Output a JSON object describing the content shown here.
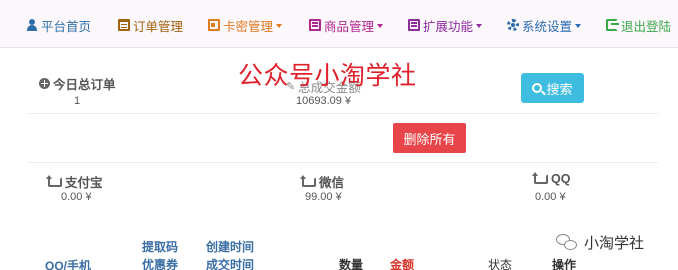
{
  "nav": {
    "items": [
      {
        "label": "平台首页",
        "icon": "user-icon",
        "color": "#2c6fa8",
        "dropdown": false
      },
      {
        "label": "订单管理",
        "icon": "list-icon",
        "color": "#a0620e",
        "dropdown": false
      },
      {
        "label": "卡密管理",
        "icon": "card-icon",
        "color": "#e07a1e",
        "dropdown": true
      },
      {
        "label": "商品管理",
        "icon": "box-icon",
        "color": "#b0278f",
        "dropdown": true
      },
      {
        "label": "扩展功能",
        "icon": "box-icon",
        "color": "#8e2c9e",
        "dropdown": true
      },
      {
        "label": "系统设置",
        "icon": "gear-icon",
        "color": "#2a6bb2",
        "dropdown": true
      },
      {
        "label": "退出登陆",
        "icon": "exit-icon",
        "color": "#3aa94a",
        "dropdown": false
      }
    ]
  },
  "watermark": "公众号小淘学社",
  "stats": {
    "today_orders": {
      "label": "今日总订单",
      "value": "1"
    },
    "total_amount": {
      "label": "总成交金额",
      "value": "10693.09 ¥"
    },
    "alipay": {
      "label": "支付宝",
      "value": "0.00 ¥"
    },
    "wechat": {
      "label": "微信",
      "value": "99.00 ¥"
    },
    "qq": {
      "label": "QQ",
      "value": "0.00 ¥"
    }
  },
  "buttons": {
    "search": "搜索",
    "delete_all": "删除所有"
  },
  "table": {
    "headers": {
      "qq_phone": "QQ/手机",
      "pickup_code": "提取码",
      "coupon": "优惠券",
      "created_time": "创建时间",
      "deal_time": "成交时间",
      "quantity": "数量",
      "amount": "金额",
      "status": "状态",
      "action": "操作"
    }
  },
  "wechat_badge": "小淘学社",
  "colors": {
    "search_button": "#3fbde0",
    "delete_button": "#e8454a",
    "watermark": "#e0212c"
  }
}
